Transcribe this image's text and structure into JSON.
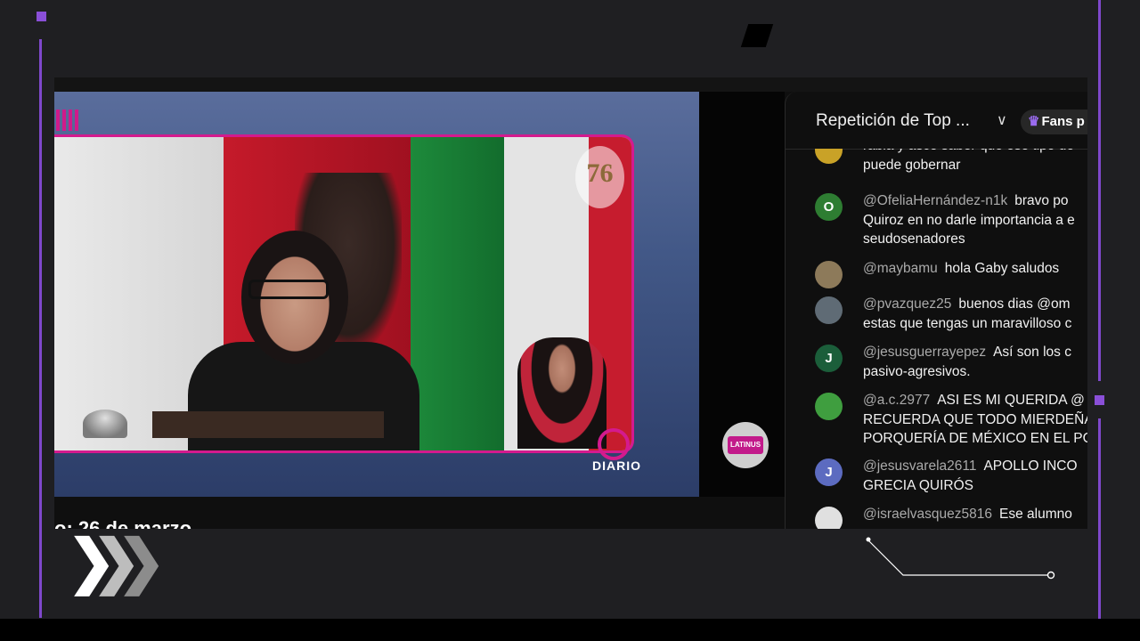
{
  "video": {
    "tv_logo_text": "76",
    "diario_label": "DIARIO",
    "latinus_label": "LATINUS",
    "date_caption": "o: 26 de marzo"
  },
  "chat": {
    "title": "Repetición de Top ...",
    "fans_label": "Fans p",
    "messages": [
      {
        "author": "",
        "avatar_letter": "",
        "avatar_color": "#c9a227",
        "lines": [
          "rabia y asco saber que ese tipo de",
          "puede gobernar"
        ]
      },
      {
        "author": "@OfeliaHernández-n1k",
        "avatar_letter": "O",
        "avatar_color": "#2e7d32",
        "lines": [
          "bravo po",
          "Quiroz en no darle importancia a e",
          "seudosenadores"
        ]
      },
      {
        "author": "@maybamu",
        "avatar_letter": "",
        "avatar_color": "#8d7a5a",
        "lines": [
          "hola Gaby saludos"
        ]
      },
      {
        "author": "@pvazquez25",
        "avatar_letter": "",
        "avatar_color": "#5f6b75",
        "lines": [
          "buenos dias @om",
          "estas que tengas un maravilloso c"
        ]
      },
      {
        "author": "@jesusguerrayepez",
        "avatar_letter": "J",
        "avatar_color": "#1b5e3a",
        "lines": [
          "Así son los c",
          "pasivo-agresivos."
        ]
      },
      {
        "author": "@a.c.2977",
        "avatar_letter": "",
        "avatar_color": "#3f9e3f",
        "lines": [
          "ASI ES MI QUERIDA @",
          "RECUERDA QUE TODO MIERDEÑA",
          "PORQUERÍA DE MÉXICO EN EL PO"
        ]
      },
      {
        "author": "@jesusvarela2611",
        "avatar_letter": "J",
        "avatar_color": "#5c6bc0",
        "lines": [
          "APOLLO INCO",
          "GRECIA QUIRÓS"
        ]
      },
      {
        "author": "@israelvasquez5816",
        "avatar_letter": "",
        "avatar_color": "#e0e0e0",
        "lines": [
          "Ese alumno"
        ]
      }
    ]
  },
  "colors": {
    "accent_purple": "#8a4fd8",
    "brand_magenta": "#d41a8e"
  }
}
